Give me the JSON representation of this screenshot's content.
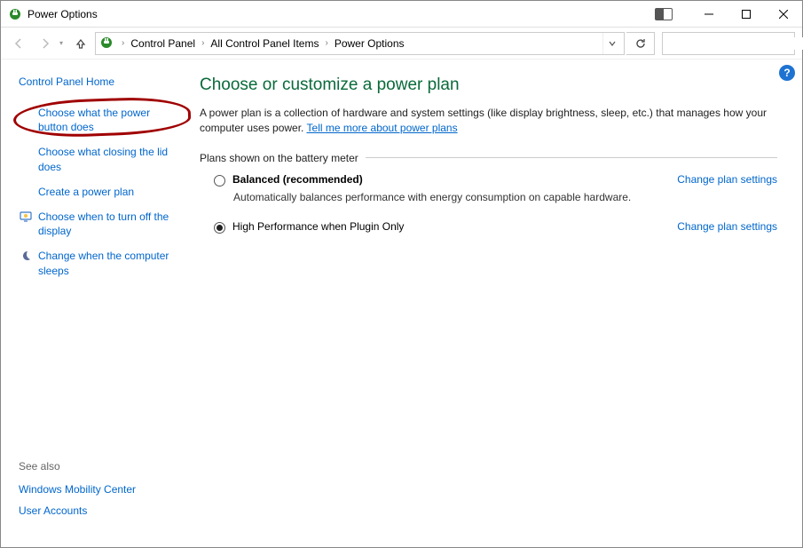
{
  "window": {
    "title": "Power Options",
    "minimize_tooltip": "Minimize",
    "maximize_tooltip": "Maximize",
    "close_tooltip": "Close"
  },
  "breadcrumbs": {
    "items": [
      "Control Panel",
      "All Control Panel Items",
      "Power Options"
    ],
    "refresh_tooltip": "Refresh"
  },
  "search": {
    "placeholder": ""
  },
  "sidebar": {
    "home": "Control Panel Home",
    "links": [
      "Choose what the power button does",
      "Choose what closing the lid does",
      "Create a power plan",
      "Choose when to turn off the display",
      "Change when the computer sleeps"
    ],
    "see_also_title": "See also",
    "see_also": [
      "Windows Mobility Center",
      "User Accounts"
    ]
  },
  "main": {
    "heading": "Choose or customize a power plan",
    "description_pre": "A power plan is a collection of hardware and system settings (like display brightness, sleep, etc.) that manages how your computer uses power. ",
    "description_link": "Tell me more about power plans",
    "meter_label": "Plans shown on the battery meter",
    "change_settings_label": "Change plan settings",
    "plans": [
      {
        "name": "Balanced (recommended)",
        "desc": "Automatically balances performance with energy consumption on capable hardware.",
        "selected": false,
        "bold": true
      },
      {
        "name": "High Performance when Plugin Only",
        "desc": "",
        "selected": true,
        "bold": false
      }
    ],
    "help_tooltip": "Help"
  }
}
